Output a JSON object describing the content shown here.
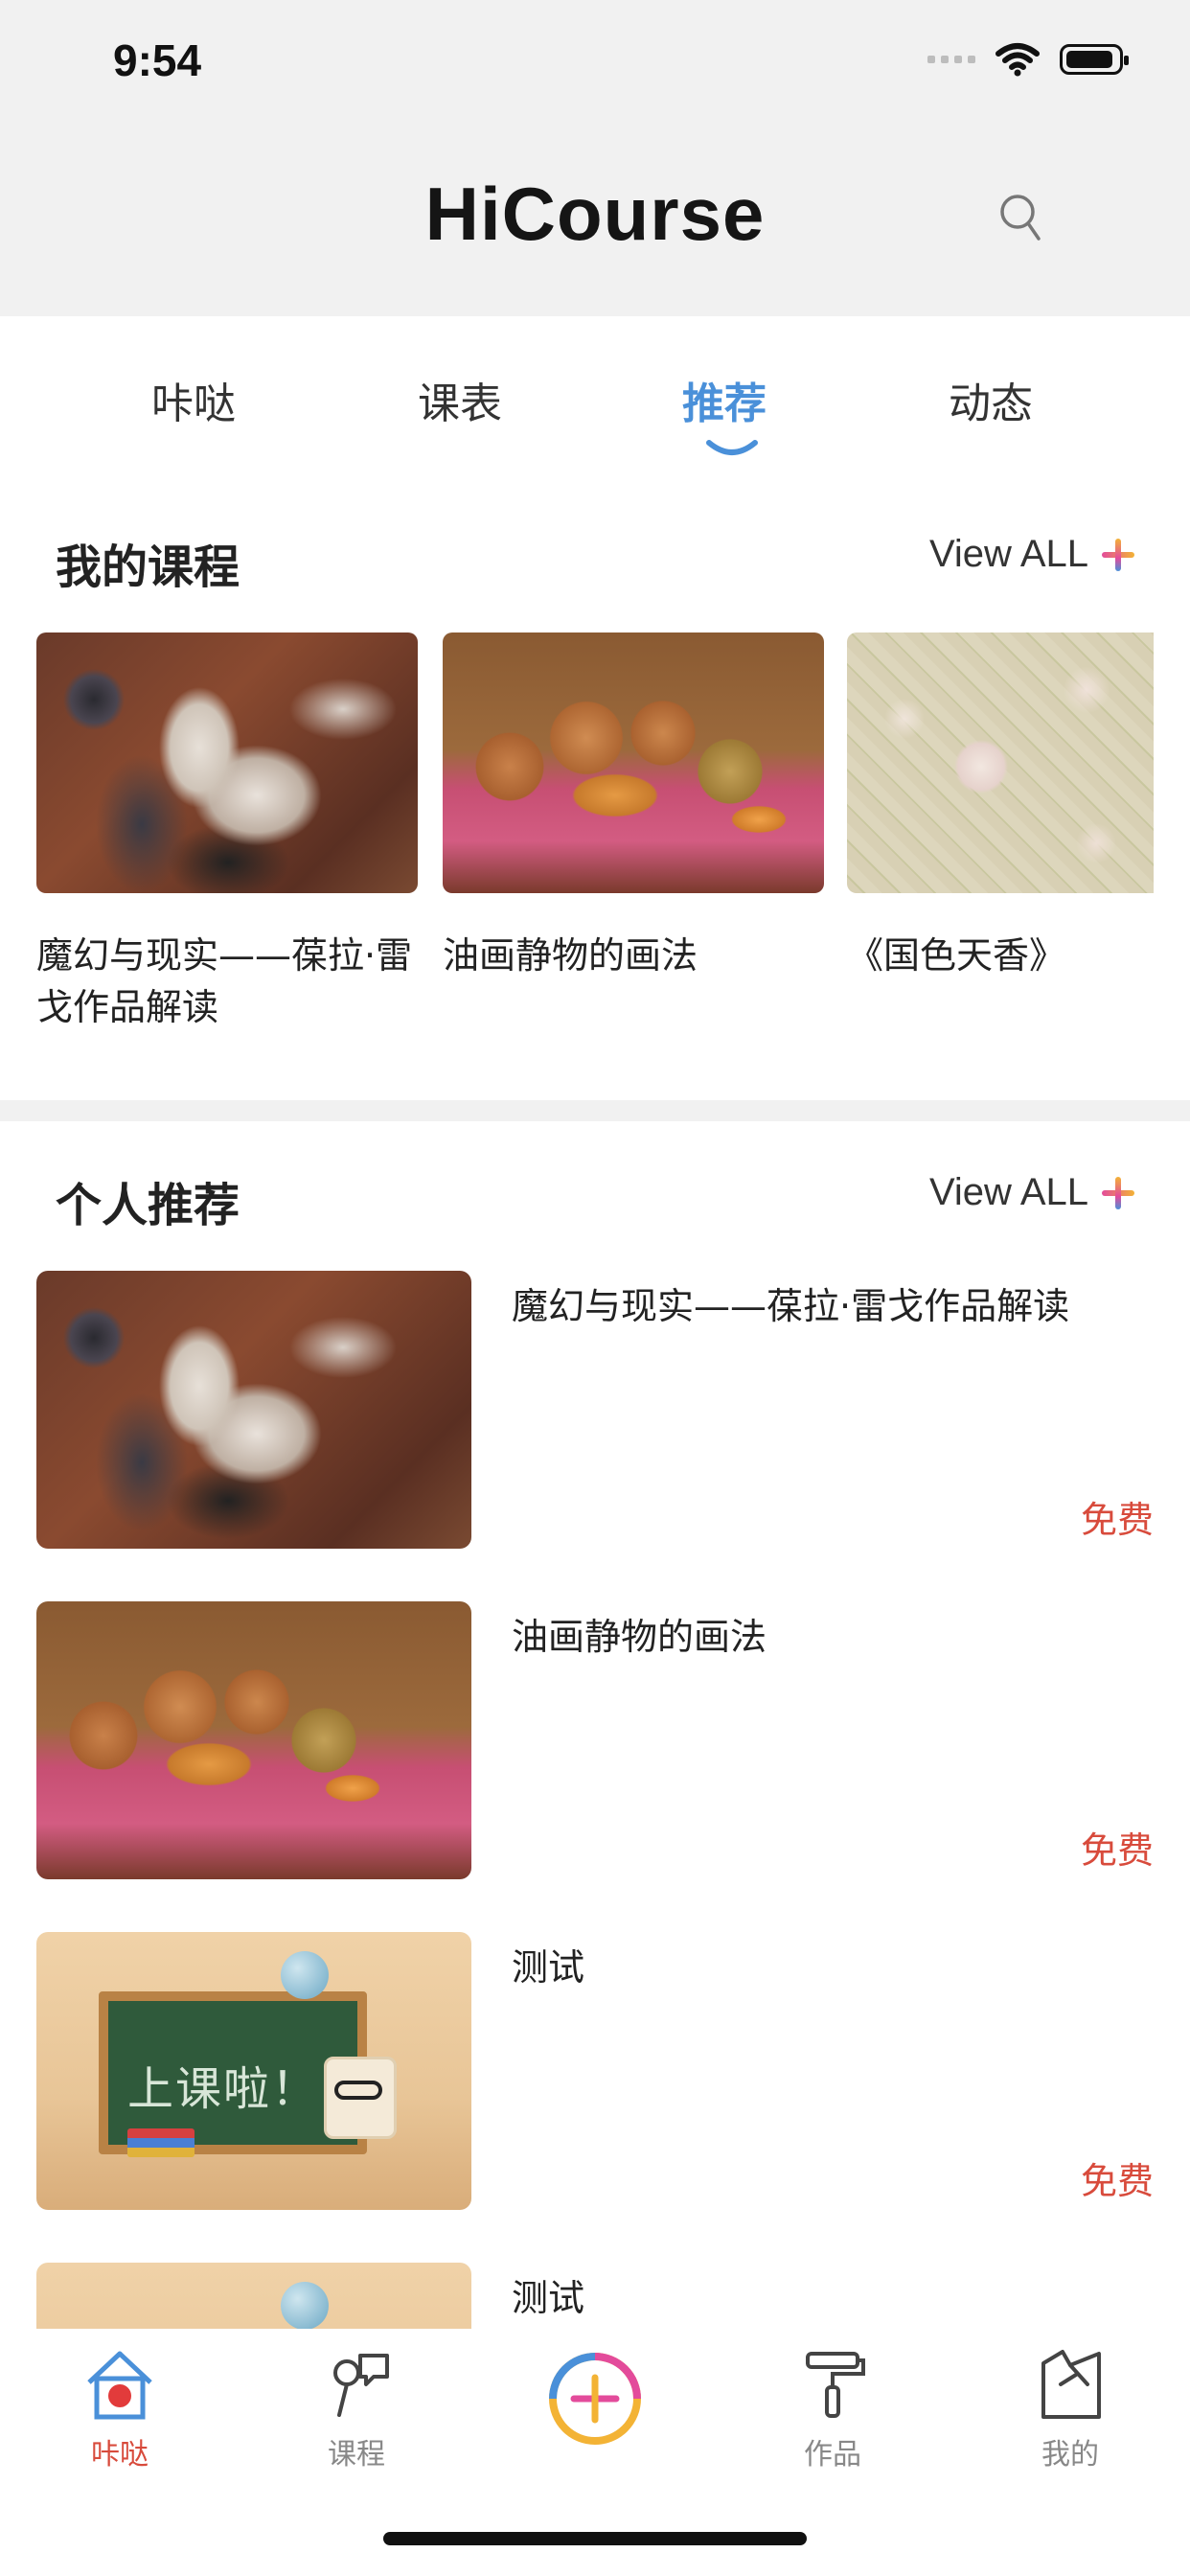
{
  "status_bar": {
    "time": "9:54"
  },
  "header": {
    "title": "HiCourse"
  },
  "tabs": [
    {
      "label": "咔哒"
    },
    {
      "label": "课表"
    },
    {
      "label": "推荐"
    },
    {
      "label": "动态"
    }
  ],
  "active_tab": "推荐",
  "my_courses": {
    "title": "我的课程",
    "view_all": "View ALL",
    "items": [
      {
        "title": "魔幻与现实——葆拉·雷戈作品解读"
      },
      {
        "title": "油画静物的画法"
      },
      {
        "title": "《国色天香》"
      }
    ]
  },
  "recommend": {
    "title": "个人推荐",
    "view_all": "View ALL",
    "items": [
      {
        "title": "魔幻与现实——葆拉·雷戈作品解读",
        "price": "免费"
      },
      {
        "title": "油画静物的画法",
        "price": "免费"
      },
      {
        "title": "测试",
        "price": "免费",
        "thumb_text": "上课啦！"
      },
      {
        "title": "测试"
      }
    ]
  },
  "bottom_nav": [
    {
      "label": "咔哒"
    },
    {
      "label": "课程"
    },
    {
      "label": ""
    },
    {
      "label": "作品"
    },
    {
      "label": "我的"
    }
  ],
  "colors": {
    "accent_blue": "#4a90d9",
    "accent_red": "#d84b3c"
  }
}
